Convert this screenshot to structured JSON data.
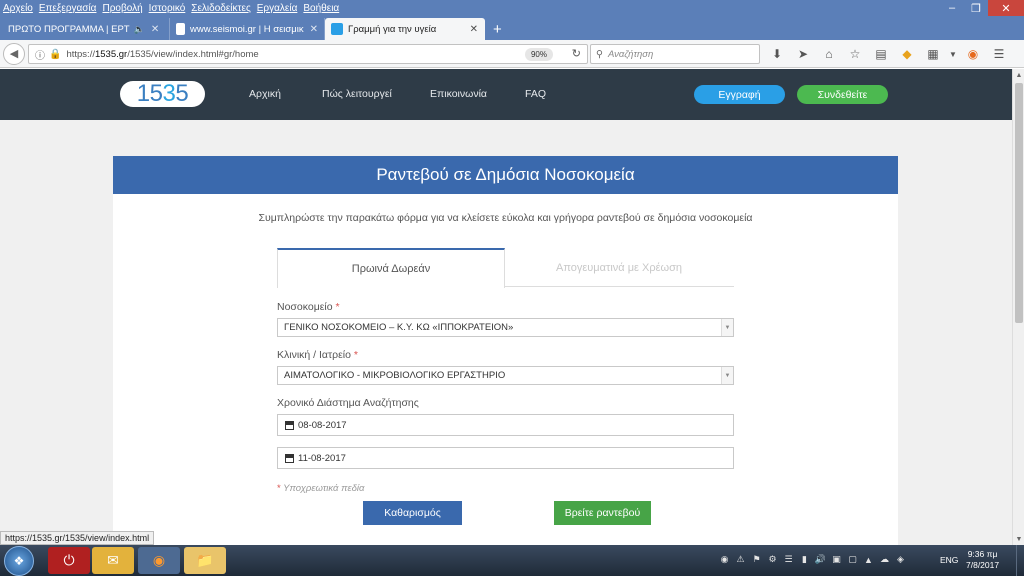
{
  "browser": {
    "menu": [
      "Αρχείο",
      "Επεξεργασία",
      "Προβολή",
      "Ιστορικό",
      "Σελιδοδείκτες",
      "Εργαλεία",
      "Βοήθεια"
    ],
    "tabs": [
      {
        "title": "ΠΡΩΤΟ ΠΡΟΓΡΑΜΜΑ | ΕΡΤ",
        "active": false
      },
      {
        "title": "www.seismoi.gr | Η σεισμικ",
        "active": false
      },
      {
        "title": "Γραμμή για την υγεία",
        "active": true
      }
    ],
    "url_prefix": "https://",
    "url_domain": "1535.gr",
    "url_rest": "/1535/view/index.html#gr/home",
    "zoom": "90%",
    "search_placeholder": "Αναζήτηση",
    "status_url": "https://1535.gr/1535/view/index.html"
  },
  "site": {
    "logo_part1": "15",
    "logo_part2": "3",
    "logo_part3": "5",
    "nav": [
      "Αρχική",
      "Πώς λειτουργεί",
      "Επικοινωνία",
      "FAQ"
    ],
    "register": "Εγγραφή",
    "login": "Συνδεθείτε"
  },
  "form": {
    "title": "Ραντεβού σε Δημόσια Νοσοκομεία",
    "subtitle": "Συμπληρώστε την παρακάτω φόρμα για να κλείσετε εύκολα και γρήγορα ραντεβού σε δημόσια νοσοκομεία",
    "tab_morning": "Πρωινά Δωρεάν",
    "tab_afternoon": "Απογευματινά με Χρέωση",
    "hospital_label": "Νοσοκομείο",
    "hospital_value": "ΓΕΝΙΚΟ ΝΟΣΟΚΟΜΕΙΟ – Κ.Υ. ΚΩ «ΙΠΠΟΚΡΑΤΕΙΟΝ»",
    "clinic_label": "Κλινική / Ιατρείο",
    "clinic_value": "ΑΙΜΑΤΟΛΟΓΙΚΟ - ΜΙΚΡΟΒΙΟΛΟΓΙΚΟ ΕΡΓΑΣΤΗΡΙΟ",
    "period_label": "Χρονικό Διάστημα Αναζήτησης",
    "date_from": "08-08-2017",
    "date_to": "11-08-2017",
    "required_star": "*",
    "required_note": "Υποχρεωτικά πεδία",
    "clear_button": "Καθαρισμός",
    "find_button": "Βρείτε ραντεβού"
  },
  "taskbar": {
    "lang": "ENG",
    "time": "9:36 πμ",
    "date": "7/8/2017"
  }
}
